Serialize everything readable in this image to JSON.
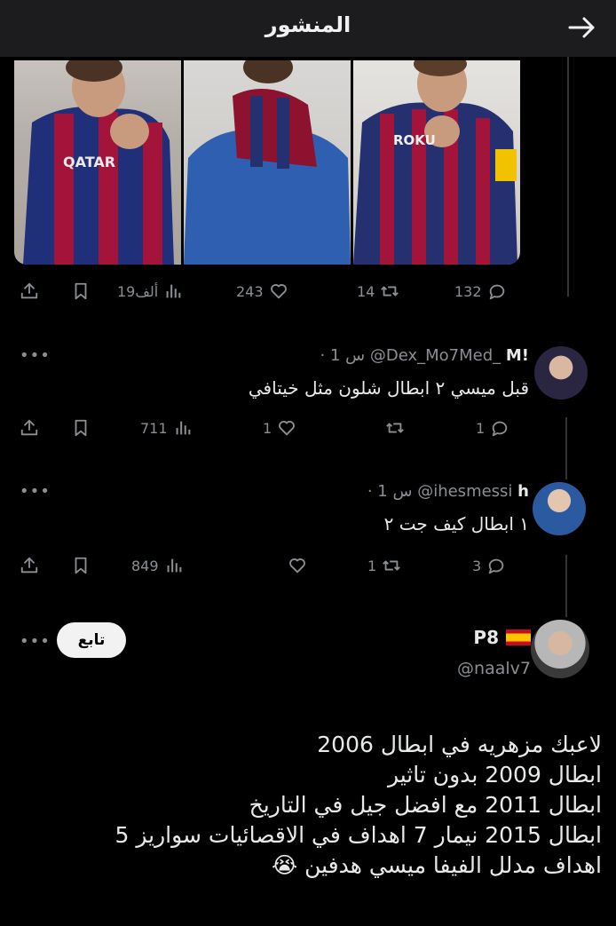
{
  "header": {
    "title": "المنشور"
  },
  "post": {
    "stats": {
      "views": "19ألف",
      "likes": "243",
      "reposts": "14",
      "replies": "132"
    }
  },
  "replies": [
    {
      "display_name": "M!",
      "handle": "@Dex_Mo7Med_",
      "time": "· 1 س",
      "text": "قبل ميسي ٢ ابطال شلون مثل خيتافي",
      "stats": {
        "views": "711",
        "likes": "1",
        "reposts": "",
        "replies": "1"
      }
    },
    {
      "display_name": "h",
      "handle": "@ihesmessi",
      "time": "· 1 س",
      "text": "١ ابطال كيف جت ٢",
      "stats": {
        "views": "849",
        "likes": "",
        "reposts": "1",
        "replies": "3"
      }
    }
  ],
  "quoted": {
    "display_name": "P8",
    "handle": "@naalv7",
    "follow_label": "تابع",
    "lines": [
      "لاعبك مزهريه في ابطال 2006",
      "ابطال 2009 بدون تاثير",
      "ابطال 2011 مع افضل جيل في التاريخ",
      "ابطال 2015 نيمار 7 اهداف في الاقصائيات سواريز 5",
      "اهداف مدلل الفيفا ميسي هدفين 😭"
    ]
  },
  "icons": {
    "share": "share-icon",
    "bookmark": "bookmark-icon",
    "views": "views-icon",
    "like": "heart-icon",
    "repost": "repost-icon",
    "reply": "reply-icon",
    "more": "more-icon",
    "back": "back-arrow-icon"
  },
  "colors": {
    "background": "#000000",
    "header": "#1c1c1e",
    "muted": "#8b8f94",
    "text": "#e7e9ea"
  }
}
